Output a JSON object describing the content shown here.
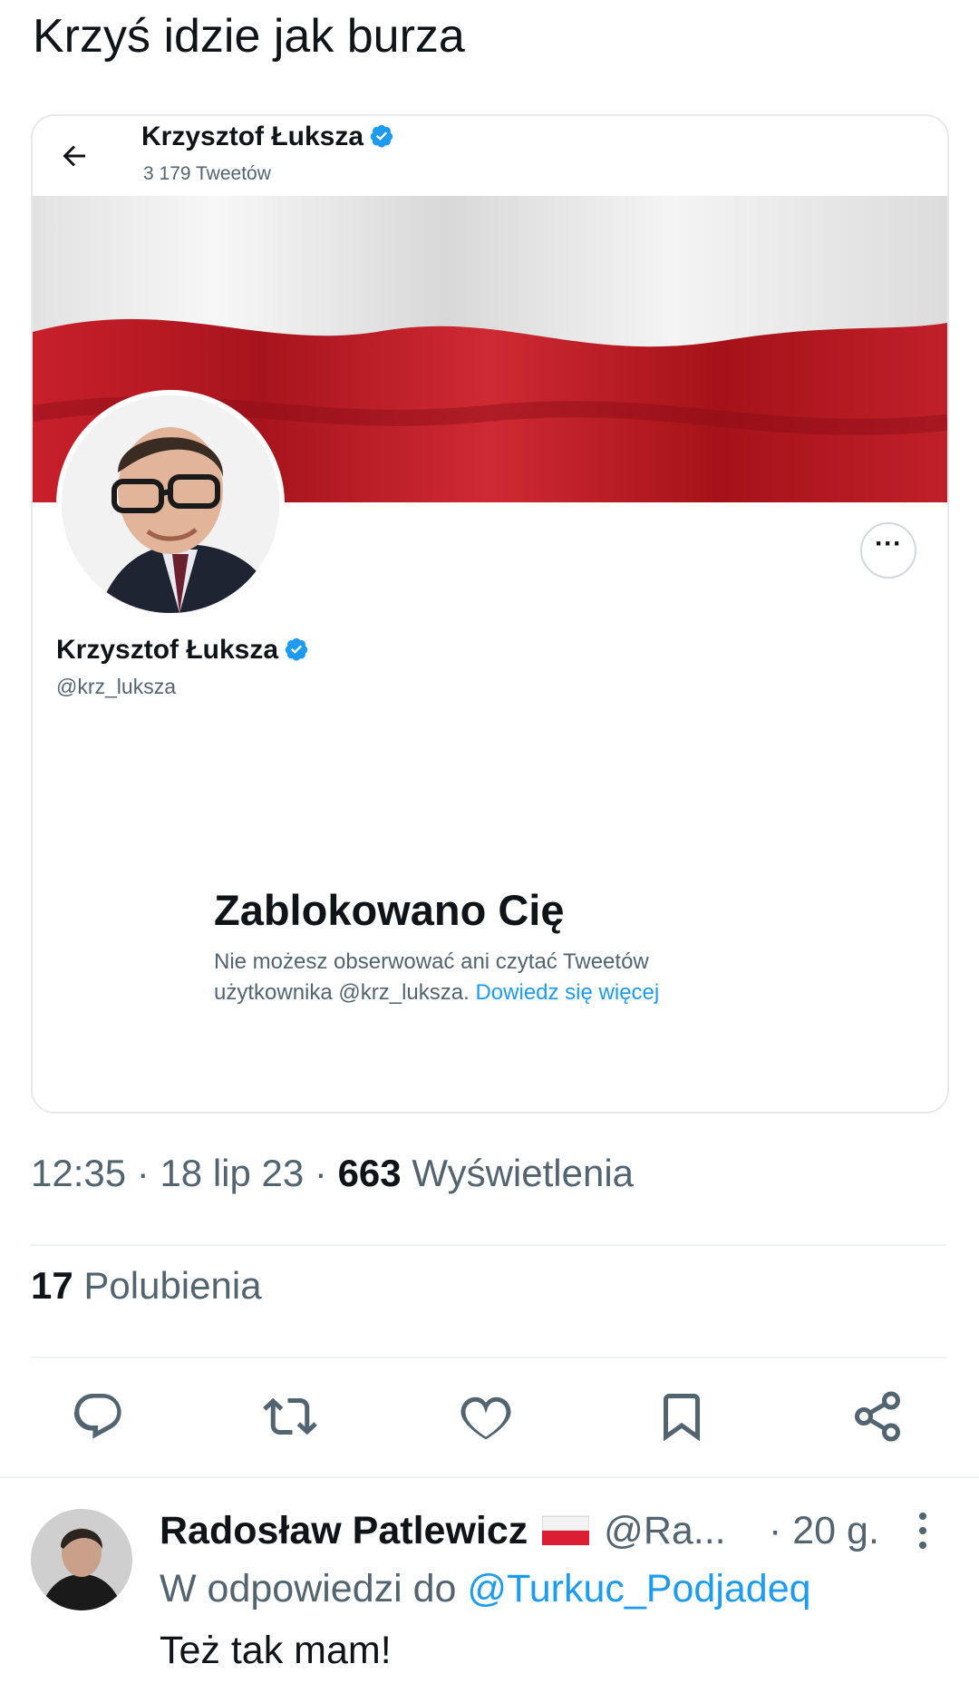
{
  "tweet": {
    "text": "Krzyś idzie jak burza"
  },
  "embedded": {
    "header_name": "Krzysztof Łuksza",
    "header_count": "3 179 Tweetów",
    "profile_name": "Krzysztof Łuksza",
    "profile_handle": "@krz_luksza",
    "more_label": "···",
    "blocked_title": "Zablokowano Cię",
    "blocked_desc": "Nie możesz obserwować ani czytać Tweetów użytkownika @krz_luksza.",
    "blocked_link": "Dowiedz się więcej"
  },
  "meta": {
    "time": "12:35",
    "date": "18 lip 23",
    "views_count": "663",
    "views_label": "Wyświetlenia",
    "sep": " · "
  },
  "likes": {
    "count": "17",
    "label": "Polubienia"
  },
  "actions": [
    "reply-icon",
    "retweet-icon",
    "like-icon",
    "bookmark-icon",
    "share-icon"
  ],
  "reply": {
    "name": "Radosław Patlewicz",
    "handle": "@Ra...",
    "time": "· 20 g.",
    "replying_prefix": "W odpowiedzi do",
    "replying_to": "@Turkuc_Podjadeq",
    "text": "Też tak mam!"
  },
  "colors": {
    "accent": "#1d9bf0",
    "muted": "#536471",
    "text": "#0f1419"
  }
}
